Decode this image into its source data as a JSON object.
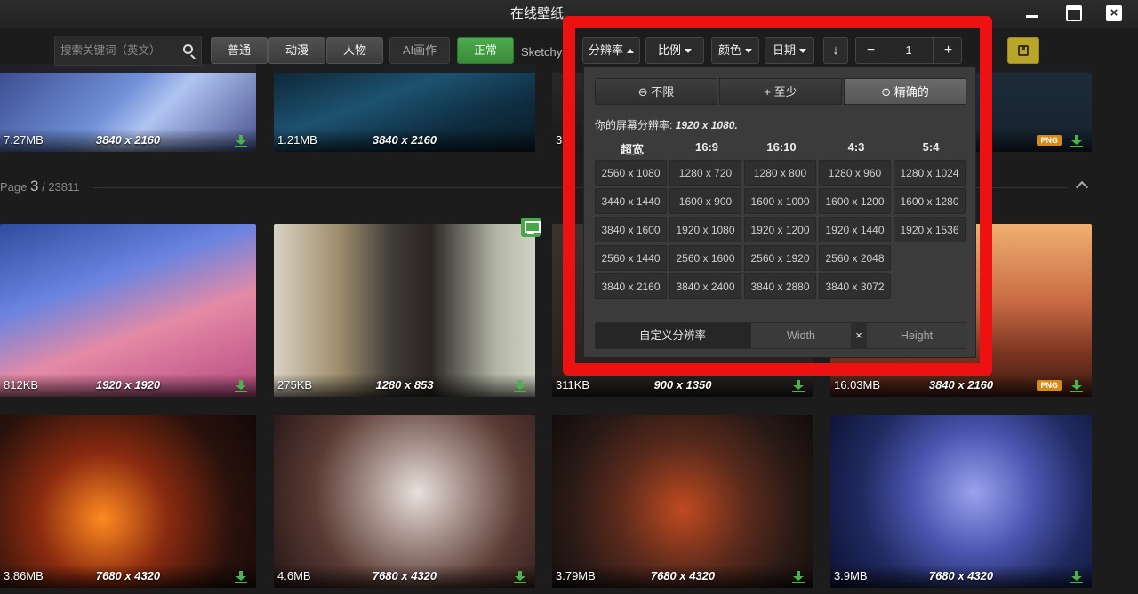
{
  "window": {
    "title": "在线壁纸"
  },
  "toolbar": {
    "search_placeholder": "搜索关键词（英文）",
    "categories": [
      "普通",
      "动漫",
      "人物"
    ],
    "ai_label": "AI画作",
    "purity": {
      "normal": "正常",
      "sketchy": "Sketchy"
    },
    "filters": {
      "resolution": "分辨率",
      "ratio": "比例",
      "color": "颜色",
      "date": "日期"
    },
    "page_value": "1",
    "minus": "−",
    "plus": "+"
  },
  "gallery": {
    "row1": [
      {
        "size": "7.27MB",
        "res": "3840 x 2160"
      },
      {
        "size": "1.21MB",
        "res": "3840 x 2160"
      },
      {
        "size": "3",
        "res": ""
      },
      {
        "size": "",
        "res": "",
        "badge": "PNG"
      }
    ],
    "page_label": "Page",
    "page_current": "3",
    "page_total": "/ 23811",
    "row2": [
      {
        "size": "812KB",
        "res": "1920 x 1920"
      },
      {
        "size": "275KB",
        "res": "1280 x 853"
      },
      {
        "size": "311KB",
        "res": "900 x 1350"
      },
      {
        "size": "16.03MB",
        "res": "3840 x 2160",
        "badge": "PNG"
      }
    ],
    "row3": [
      {
        "size": "3.86MB",
        "res": "7680 x 4320"
      },
      {
        "size": "4.6MB",
        "res": "7680 x 4320"
      },
      {
        "size": "3.79MB",
        "res": "7680 x 4320"
      },
      {
        "size": "3.9MB",
        "res": "7680 x 4320"
      }
    ]
  },
  "resolution_panel": {
    "modes": [
      "⊖ 不限",
      "+ 至少",
      "⊙ 精确的"
    ],
    "selected_mode": "⊙ 精确的",
    "screen_label": "你的屏幕分辨率:",
    "screen_value": "1920 x 1080.",
    "columns": [
      "超宽",
      "16:9",
      "16:10",
      "4:3",
      "5:4"
    ],
    "cells": [
      [
        "2560 x 1080",
        "3440 x 1440",
        "3840 x 1600",
        "2560 x 1440",
        "3840 x 2160"
      ],
      [
        "1280 x 720",
        "1600 x 900",
        "1920 x 1080",
        "2560 x 1600",
        "3840 x 2400"
      ],
      [
        "1280 x 800",
        "1600 x 1000",
        "1920 x 1200",
        "2560 x 1920",
        "3840 x 2880"
      ],
      [
        "1280 x 960",
        "1600 x 1200",
        "1920 x 1440",
        "2560 x 2048",
        "3840 x 3072"
      ],
      [
        "1280 x 1024",
        "1600 x 1280",
        "1920 x 1536"
      ]
    ],
    "custom_label": "自定义分辨率",
    "width_placeholder": "Width",
    "times": "×",
    "height_placeholder": "Height"
  },
  "colors": {
    "annotation": "#ee1111",
    "active_green": "#4caa4c",
    "download_green": "#4bb34b",
    "png_badge": "#d68a1a"
  }
}
